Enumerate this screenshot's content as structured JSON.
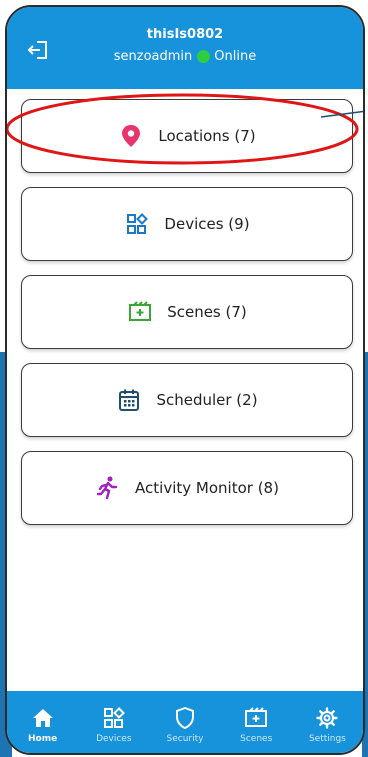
{
  "header": {
    "username": "thisIs0802",
    "account": "senzoadmin",
    "status": "Online"
  },
  "menu": [
    {
      "label": "Locations (7)",
      "icon": "location-pin-icon"
    },
    {
      "label": "Devices (9)",
      "icon": "devices-grid-icon"
    },
    {
      "label": "Scenes (7)",
      "icon": "scenes-icon"
    },
    {
      "label": "Scheduler (2)",
      "icon": "calendar-icon"
    },
    {
      "label": "Activity Monitor (8)",
      "icon": "running-person-icon"
    }
  ],
  "nav": [
    {
      "label": "Home",
      "icon": "home-icon",
      "active": true
    },
    {
      "label": "Devices",
      "icon": "devices-grid-icon"
    },
    {
      "label": "Security",
      "icon": "shield-icon"
    },
    {
      "label": "Scenes",
      "icon": "scenes-icon"
    },
    {
      "label": "Settings",
      "icon": "gear-icon"
    }
  ],
  "colors": {
    "header": "#1793db",
    "status_online": "#2ecc40",
    "annotation": "#e01515",
    "location_icon": "#e8356d",
    "devices_icon": "#1a7bc4",
    "scenes_icon": "#3aa635",
    "calendar_icon": "#1f4e73",
    "activity_icon": "#a020c0"
  }
}
